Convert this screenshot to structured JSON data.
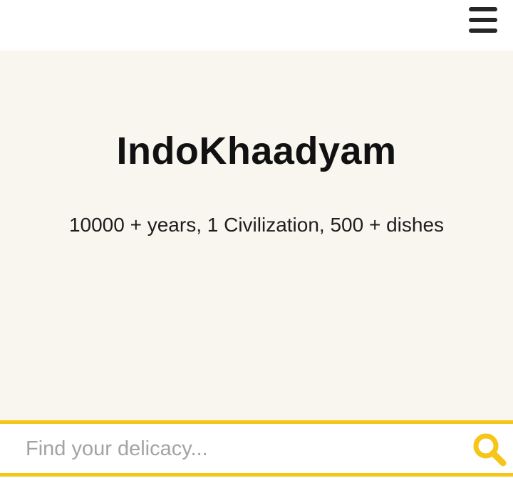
{
  "header": {
    "menu_icon": "hamburger-menu-icon"
  },
  "hero": {
    "title": "IndoKhaadyam",
    "subtitle": "10000 + years, 1 Civilization, 500 + dishes",
    "background_color": "#f9f6ef"
  },
  "search": {
    "placeholder": "Find your delicacy...",
    "value": "",
    "icon": "search-icon",
    "accent_color": "#f5c518"
  }
}
